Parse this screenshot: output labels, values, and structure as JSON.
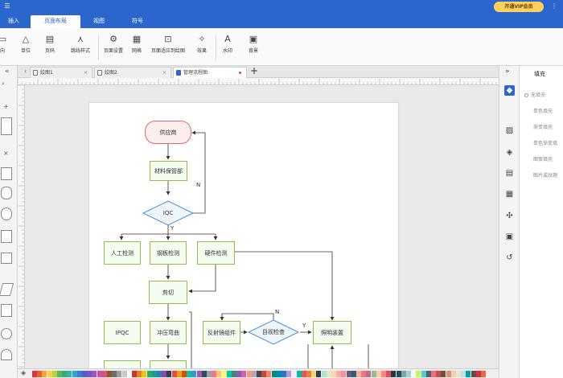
{
  "menu": {
    "tabs": [
      {
        "label": "插入",
        "active": false
      },
      {
        "label": "页面布局",
        "active": true
      },
      {
        "label": "视图",
        "active": false
      },
      {
        "label": "符号",
        "active": false
      }
    ],
    "vip_label": "开通VIP会员"
  },
  "toolbar": {
    "items": [
      {
        "label": "向",
        "icon": "direction-icon"
      },
      {
        "label": "单位",
        "icon": "unit-icon"
      },
      {
        "label": "页码",
        "icon": "page-number-icon"
      },
      {
        "label": "跳线样式",
        "icon": "jump-line-icon"
      },
      {
        "label": "页面设置",
        "icon": "page-setup-icon"
      },
      {
        "label": "网格",
        "icon": "grid-icon"
      },
      {
        "label": "页面适应到绘图",
        "icon": "fit-page-icon"
      },
      {
        "label": "效果",
        "icon": "effects-icon"
      },
      {
        "label": "水印",
        "icon": "watermark-icon"
      },
      {
        "label": "背景",
        "icon": "background-icon"
      }
    ]
  },
  "doc_tabs": [
    {
      "label": "绘图1",
      "active": false,
      "modified": false
    },
    {
      "label": "绘图2",
      "active": false,
      "modified": false
    },
    {
      "label": "管理流程图",
      "active": true,
      "modified": true
    }
  ],
  "flowchart": {
    "supplier": "供应商",
    "materials": "材料保管部",
    "iqc": "IQC",
    "manual_check": "人工检测",
    "board_check": "钢板检测",
    "hardware_check": "硬件检测",
    "cut": "剪切",
    "ipqc": "IPQC",
    "stamping": "冲压弯曲",
    "reflector": "反射镜组件",
    "visual_check": "目视检查",
    "lighting": "照明装置",
    "label_n1": "N",
    "label_y1": "Y",
    "label_n2": "N",
    "label_y2": "Y"
  },
  "right_panel": {
    "title": "填充",
    "options": [
      "无填充",
      "单色填充",
      "渐变填充",
      "单色渐变填",
      "图案填充",
      "图片或纹理"
    ]
  },
  "side_icons": [
    "fill-icon",
    "image-icon",
    "layers-icon",
    "page-icon",
    "chart-icon",
    "connect-icon",
    "present-icon",
    "history-icon"
  ],
  "colors": {
    "accent": "#2a66cc",
    "process_border": "#8cc152",
    "supplier_border": "#e06b6b",
    "decision_border": "#4a90d9"
  },
  "palette": [
    "#d9363e",
    "#e8612c",
    "#f2a33a",
    "#f7d046",
    "#b7d43e",
    "#5cb85c",
    "#3aa776",
    "#2cb5a8",
    "#2fa4d9",
    "#3a7bd5",
    "#4f5fd0",
    "#7b4fd0",
    "#a64fc9",
    "#d04fa9",
    "#e0507a",
    "#8b5a2b",
    "#6d6d6d",
    "#9e9e9e",
    "#c8c8c8",
    "#ffffff",
    "#c0392b",
    "#e67e22",
    "#f1c40f",
    "#27ae60",
    "#16a085",
    "#2980b9",
    "#8e44ad",
    "#2c3e50",
    "#e74c3c",
    "#f39c12",
    "#d35400",
    "#1abc9c",
    "#3498db",
    "#9b59b6",
    "#34495e",
    "#95a5a6",
    "#ff6f91",
    "#ffc75f",
    "#f9f871",
    "#00c9a7",
    "#4d8076",
    "#845ec2",
    "#d65db1",
    "#ff9671",
    "#b0a8b9",
    "#4b4453",
    "#c34a36",
    "#ff8066",
    "#008f7a",
    "#0089ba",
    "#2c73d2",
    "#b39cd0",
    "#fbeaff",
    "#00c2a8",
    "#ea5455",
    "#f07b3f",
    "#ffd460",
    "#2d4059",
    "#a8e6cf",
    "#dcedc1",
    "#ffd3b6",
    "#ffaaa5",
    "#ff8b94",
    "#6c5b7b",
    "#355c7d",
    "#f8b195",
    "#f67280",
    "#c06c84",
    "#99b898",
    "#feceab",
    "#ff847c",
    "#e84a5f",
    "#2a363b",
    "#1f4e5f",
    "#79a8a9",
    "#aacfd0",
    "#f4f7f7",
    "#c7f464",
    "#4ecdc4",
    "#556270",
    "#ff6b6b",
    "#c44d58",
    "#774f38",
    "#e08e79",
    "#f1d4af",
    "#ece5ce",
    "#c5e0dc",
    "#00a0b0",
    "#6a4a3c",
    "#cc333f",
    "#eb6841"
  ]
}
